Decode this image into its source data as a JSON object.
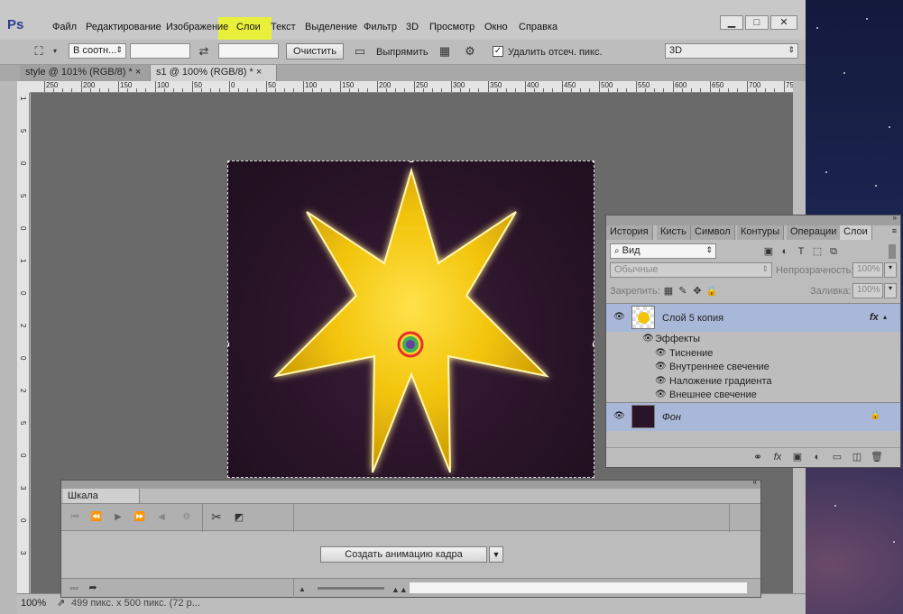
{
  "app": {
    "logo": "Ps"
  },
  "menu": [
    "Файл",
    "Редактирование",
    "Изображение",
    "Слои",
    "Текст",
    "Выделение",
    "Фильтр",
    "3D",
    "Просмотр",
    "Окно",
    "Справка"
  ],
  "window_controls": {
    "min": "▁",
    "max": "□",
    "close": "✕"
  },
  "options": {
    "ratio": "В соотн...",
    "clear": "Очистить",
    "straighten": "Выпрямить",
    "delete_crop": "Удалить отсеч. пикс.",
    "workspace": "3D"
  },
  "tabs": [
    {
      "label": "style @ 101% (RGB/8) *",
      "close": "×"
    },
    {
      "label": "s1 @ 100% (RGB/8) *",
      "close": "×"
    }
  ],
  "ruler_h": [
    "250",
    "200",
    "150",
    "100",
    "50",
    "0",
    "50",
    "100",
    "150",
    "200",
    "250",
    "300",
    "350",
    "400",
    "450",
    "500",
    "550",
    "600",
    "650",
    "700",
    "75"
  ],
  "ruler_v": [
    "1",
    "5",
    "0",
    "5",
    "0",
    "1",
    "0",
    "2",
    "0",
    "2",
    "5",
    "0",
    "3",
    "0",
    "3"
  ],
  "status": {
    "zoom": "100%",
    "info": "499 пикс. x 500 пикс. (72 р..."
  },
  "layers_panel": {
    "tabs": [
      "История",
      "Кисть",
      "Символ",
      "Контуры",
      "Операции",
      "Слои"
    ],
    "filter": "Вид",
    "blend": "Обычные",
    "opacity_label": "Непрозрачность:",
    "opacity_value": "100%",
    "lock_label": "Закрепить:",
    "fill_label": "Заливка:",
    "fill_value": "100%",
    "layer1": "Слой 5 копия",
    "fx": "fx",
    "effects": "Эффекты",
    "effect_items": [
      "Тиснение",
      "Внутреннее свечение",
      "Наложение градиента",
      "Внешнее свечение"
    ],
    "layer2": "Фон"
  },
  "timeline": {
    "title": "Шкала времени",
    "create": "Создать анимацию кадра"
  },
  "colors": {
    "star": "#f2c40a",
    "highlight": "#e8f03b",
    "selected_layer": "#a9b8d8"
  }
}
